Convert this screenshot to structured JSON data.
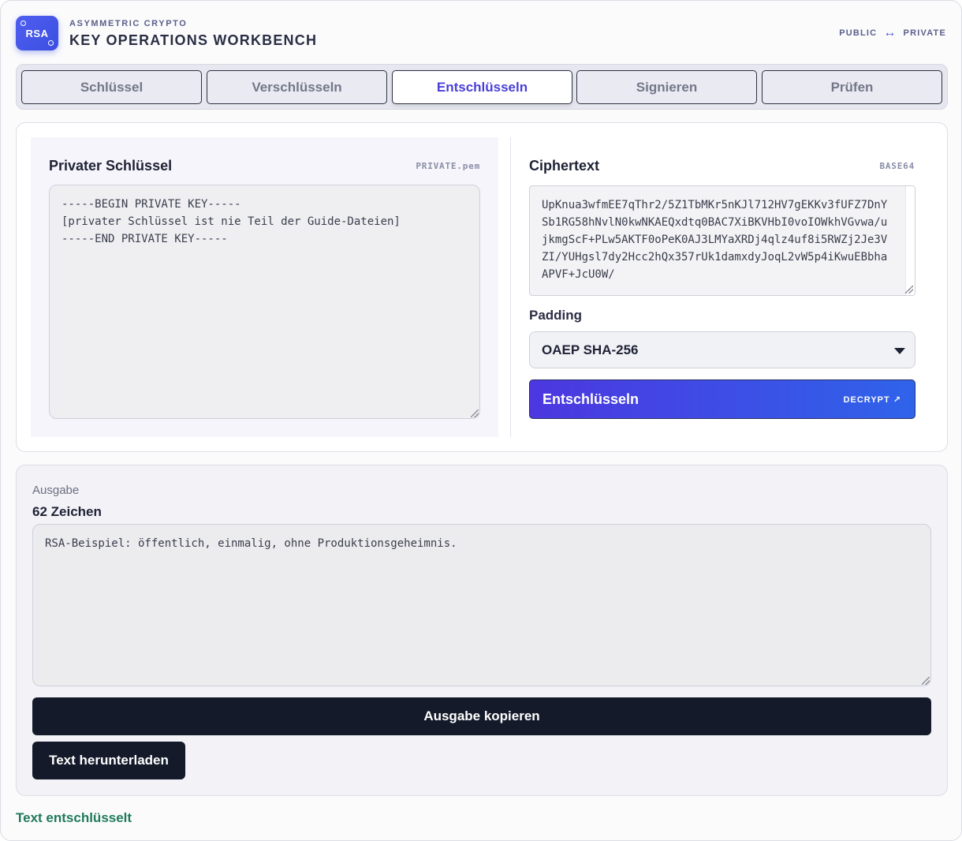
{
  "header": {
    "logo_text": "RSA",
    "eyebrow": "ASYMMETRIC CRYPTO",
    "title": "KEY OPERATIONS WORKBENCH",
    "badge_left": "PUBLIC",
    "badge_icon": "↔",
    "badge_right": "PRIVATE"
  },
  "tabs": [
    {
      "label": "Schlüssel"
    },
    {
      "label": "Verschlüsseln"
    },
    {
      "label": "Entschlüsseln",
      "active": true
    },
    {
      "label": "Signieren"
    },
    {
      "label": "Prüfen"
    }
  ],
  "private_key": {
    "title": "Privater Schlüssel",
    "tag": "PRIVATE.pem",
    "value": "-----BEGIN PRIVATE KEY-----\n[privater Schlüssel ist nie Teil der Guide-Dateien]\n-----END PRIVATE KEY-----"
  },
  "ciphertext": {
    "title": "Ciphertext",
    "tag": "BASE64",
    "value": "UpKnua3wfmEE7qThr2/5Z1TbMKr5nKJl712HV7gEKKv3fUFZ7DnYSb1RG58hNvlN0kwNKAEQxdtq0BAC7XiBKVHbI0voIOWkhVGvwa/ujkmgScF+PLw5AKTF0oPeK0AJ3LMYaXRDj4qlz4uf8i5RWZj2Je3VZI/YUHgsl7dy2Hcc2hQx357rUk1damxdyJoqL2vW5p4iKwuEBbhaAPVF+JcU0W/"
  },
  "padding": {
    "label": "Padding",
    "selected": "OAEP SHA-256"
  },
  "decrypt_button": {
    "label": "Entschlüsseln",
    "tag": "DECRYPT ↗"
  },
  "output": {
    "label": "Ausgabe",
    "count": "62 Zeichen",
    "value": "RSA-Beispiel: öffentlich, einmalig, ohne Produktionsgeheimnis.",
    "copy_label": "Ausgabe kopieren",
    "download_label": "Text herunterladen"
  },
  "status": "Text entschlüsselt"
}
